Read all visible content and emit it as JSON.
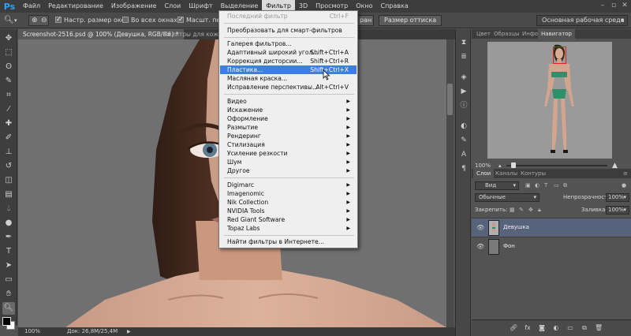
{
  "app": {
    "logo": "Ps"
  },
  "menubar": {
    "items": [
      "Файл",
      "Редактирование",
      "Изображение",
      "Слои",
      "Шрифт",
      "Выделение",
      "Фильтр",
      "3D",
      "Просмотр",
      "Окно",
      "Справка"
    ],
    "active": "Фильтр"
  },
  "options": {
    "fit_windows": "Настр. размер окон",
    "all_windows": "Во всех окнах",
    "scrubby_zoom": "Масшт. перетаскива",
    "fit_screen_partial": "ран",
    "print_size": "Размер оттиска",
    "workspace": "Основная рабочая среда"
  },
  "document": {
    "tab_title": "Screenshot-2516.psd @ 100% (Девушка, RGB/8#) *",
    "second_tab": "Палитры для кожи.p",
    "zoom": "100%",
    "doc_size": "Док: 26,8M/25,4M"
  },
  "filter_menu": {
    "last_filter": {
      "label": "Последний фильтр",
      "shortcut": "Ctrl+F"
    },
    "smart_filters": "Преобразовать для смарт-фильтров",
    "group1": [
      {
        "label": "Галерея фильтров...",
        "shortcut": ""
      },
      {
        "label": "Адаптивный широкий угол...",
        "shortcut": "Shift+Ctrl+A"
      },
      {
        "label": "Коррекция дисторсии...",
        "shortcut": "Shift+Ctrl+R"
      },
      {
        "label": "Пластика...",
        "shortcut": "Shift+Ctrl+X"
      },
      {
        "label": "Масляная краска...",
        "shortcut": ""
      },
      {
        "label": "Исправление перспективы...",
        "shortcut": "Alt+Ctrl+V"
      }
    ],
    "group2": [
      "Видео",
      "Искажение",
      "Оформление",
      "Размытие",
      "Рендеринг",
      "Стилизация",
      "Усиление резкости",
      "Шум",
      "Другое"
    ],
    "group3": [
      "Digimarc",
      "Imagenomic",
      "Nik Collection",
      "NVIDIA Tools",
      "Red Giant Software",
      "Topaz Labs"
    ],
    "browse_online": "Найти фильтры в Интернете..."
  },
  "navigator": {
    "tabs": [
      "Цвет",
      "Образцы",
      "Инфо",
      "Навигатор"
    ],
    "active_tab": "Навигатор",
    "zoom": "100%"
  },
  "layers_panel": {
    "tabs": [
      "Слои",
      "Каналы",
      "Контуры"
    ],
    "active_tab": "Слои",
    "filter_kind": "Вид",
    "blend_mode": "Обычные",
    "opacity_label": "Непрозрачность:",
    "opacity": "100%",
    "lock_label": "Закрепить:",
    "fill_label": "Заливка:",
    "fill": "100%",
    "layers": [
      {
        "name": "Девушка",
        "selected": true
      },
      {
        "name": "Фон",
        "selected": false
      }
    ]
  },
  "colors": {
    "accent_highlight": "#3d7ee6",
    "menubar": "#3c3c3c",
    "selected_layer": "#56637a"
  }
}
